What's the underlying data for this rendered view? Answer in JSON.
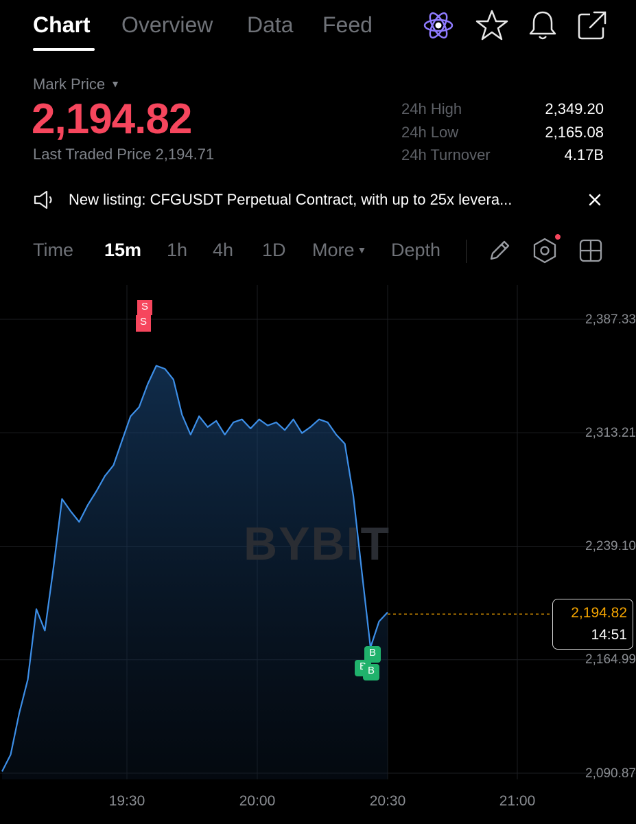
{
  "tabs": [
    "Chart",
    "Overview",
    "Data",
    "Feed"
  ],
  "top_icons": [
    "atom-icon",
    "star-icon",
    "bell-icon",
    "share-icon"
  ],
  "price": {
    "mark_label": "Mark Price",
    "mark_price": "2,194.82",
    "last_traded_label": "Last Traded Price 2,194.71",
    "stats": [
      {
        "label": "24h High",
        "value": "2,349.20"
      },
      {
        "label": "24h Low",
        "value": "2,165.08"
      },
      {
        "label": "24h Turnover",
        "value": "4.17B"
      }
    ]
  },
  "announcement": {
    "text": "New listing: CFGUSDT Perpetual Contract, with up to 25x levera..."
  },
  "toolbar": {
    "time_label": "Time",
    "intervals": [
      "15m",
      "1h",
      "4h",
      "1D"
    ],
    "active_interval": "15m",
    "more_label": "More",
    "depth_label": "Depth"
  },
  "colors": {
    "accent_red": "#f6465d",
    "line_blue": "#3d8fe8",
    "buy_green": "#20b26c",
    "price_tag_orange": "#f7a600"
  },
  "chart_data": {
    "type": "area",
    "watermark": "BYBIT",
    "y_ticks": [
      "2,387.33",
      "2,313.21",
      "2,239.10",
      "2,164.99",
      "2,090.87"
    ],
    "x_ticks": [
      "19:30",
      "20:00",
      "20:30",
      "21:00"
    ],
    "ylim": [
      2090.87,
      2387.33
    ],
    "current_price": "2,194.82",
    "countdown": "14:51",
    "markers": [
      {
        "type": "sell",
        "label": "S"
      },
      {
        "type": "sell",
        "label": "S"
      },
      {
        "type": "buy",
        "label": "B"
      },
      {
        "type": "buy",
        "label": "B"
      },
      {
        "type": "buy",
        "label": "B"
      }
    ],
    "series": [
      {
        "x": [
          "19:00",
          "19:02",
          "19:04",
          "19:06",
          "19:08",
          "19:10",
          "19:12",
          "19:14",
          "19:16",
          "19:18",
          "19:20",
          "19:22",
          "19:24",
          "19:26",
          "19:28",
          "19:30",
          "19:32",
          "19:34",
          "19:36",
          "19:38",
          "19:40",
          "19:42",
          "19:44",
          "19:46",
          "19:48",
          "19:50",
          "19:52",
          "19:54",
          "19:56",
          "19:58",
          "20:00",
          "20:02",
          "20:04",
          "20:06",
          "20:08",
          "20:10",
          "20:12",
          "20:14",
          "20:16",
          "20:18",
          "20:20",
          "20:22",
          "20:24",
          "20:26",
          "20:28",
          "20:30"
        ],
        "values": [
          2092,
          2103,
          2130,
          2152,
          2198,
          2184,
          2225,
          2270,
          2262,
          2255,
          2266,
          2275,
          2285,
          2292,
          2308,
          2324,
          2330,
          2345,
          2357,
          2355,
          2348,
          2325,
          2312,
          2324,
          2317,
          2321,
          2312,
          2320,
          2322,
          2316,
          2322,
          2318,
          2320,
          2315,
          2322,
          2313,
          2317,
          2322,
          2320,
          2312,
          2306,
          2272,
          2222,
          2173,
          2190,
          2196
        ]
      }
    ]
  }
}
